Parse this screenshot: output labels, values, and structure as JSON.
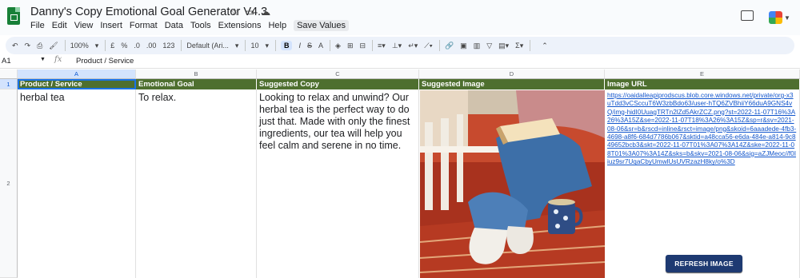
{
  "doc": {
    "title": "Danny's Copy Emotional Goal Generator V4.3",
    "menu": [
      "File",
      "Edit",
      "View",
      "Insert",
      "Format",
      "Data",
      "Tools",
      "Extensions",
      "Help"
    ],
    "save_values": "Save Values"
  },
  "toolbar": {
    "zoom": "100%",
    "currency": "£",
    "percent": "%",
    "dec_decrease": ".0",
    "dec_increase": ".00",
    "more_formats": "123",
    "font": "Default (Ari...",
    "font_size": "10",
    "bold": "B",
    "italic": "I",
    "strike": "S",
    "text_color": "A"
  },
  "formula_bar": {
    "cell_ref": "A1",
    "fx": "fx",
    "content": "Product / Service"
  },
  "grid": {
    "columns": [
      "A",
      "B",
      "C",
      "D",
      "E"
    ],
    "rows": [
      "1",
      "2"
    ],
    "headers": [
      "Product / Service",
      "Emotional Goal",
      "Suggested Copy",
      "Suggested Image",
      "Image URL"
    ],
    "row2": {
      "product": "herbal tea",
      "goal": "To relax.",
      "copy": "Looking to relax and unwind? Our herbal tea is the perfect way to do just that. Made with only the finest ingredients, our tea will help you feel calm and serene in no time.",
      "image_url": "https://oaidalleapiprodscus.blob.core.windows.net/private/org-x3uTdd3vCSccuT6W3zbBdo63/user-hTQ6ZVBhiiY66duA9GNS4vQ/img-hidI0UuagTRTn2lZd5AkrZCZ.png?st=2022-11-07T16%3A26%3A15Z&se=2022-11-07T18%3A26%3A15Z&sp=r&sv=2021-08-06&sr=b&rscd=inline&rsct=image/png&skoid=6aaadede-4fb3-4698-a8f6-684d7786b067&sktid=a48cca56-e6da-484e-a814-9c849652bcb3&skt=2022-11-07T01%3A07%3A14Z&ske=2022-11-08T01%3A07%3A14Z&sks=b&skv=2021-08-06&sig=aZJMeoc//f0Iiuz9sr7UqaCbyUmwlUsUVRzazH8ky/o%3D"
    },
    "refresh_button": "REFRESH IMAGE"
  },
  "colors": {
    "header_green": "#4e6f2f",
    "sheets_green": "#188038",
    "button_navy": "#1e3a72",
    "link_blue": "#1155cc"
  }
}
